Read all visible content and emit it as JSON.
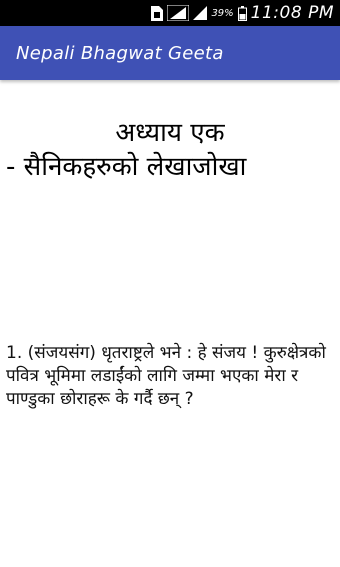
{
  "status_bar": {
    "battery_percent": "39%",
    "time": "11:08 PM",
    "icons": [
      "sim-card-icon",
      "signal-icon",
      "signal-icon",
      "battery-icon"
    ]
  },
  "app_bar": {
    "title": "Nepali Bhagwat Geeta",
    "color": "#3f51b5"
  },
  "chapter": {
    "title": "अध्याय एक",
    "subtitle": "-  सैनिकहरुको लेखाजोखा"
  },
  "verse": {
    "text": "1. (संजयसंग) धृतराष्ट्रले भने : हे संजय ! कुरुक्षेत्रको पवित्र भूमिमा लडाईंको लागि जम्मा भएका मेरा र पाण्डुका छोराहरू के गर्दै छन् ?"
  }
}
